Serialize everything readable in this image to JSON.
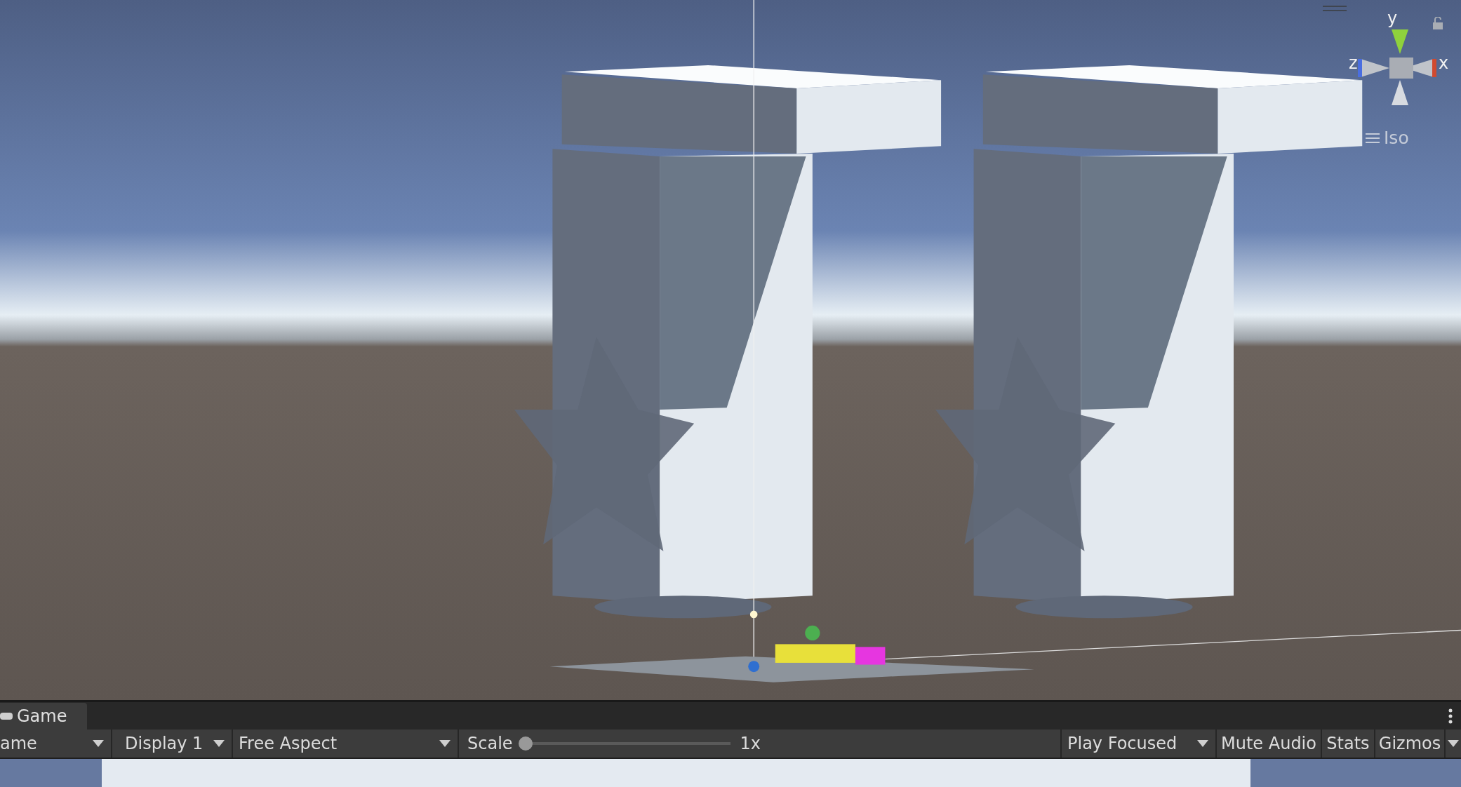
{
  "scene_view": {
    "gizmo": {
      "axis_labels": [
        {
          "kind": "y",
          "label": "y"
        },
        {
          "kind": "x",
          "label": "x"
        },
        {
          "kind": "z",
          "label": "z"
        }
      ],
      "projection": "Iso"
    }
  },
  "game_panel": {
    "tabs": [
      {
        "label": "Game",
        "selected": true
      }
    ],
    "toolbar": {
      "view_dropdown": "ame",
      "display_dropdown": "Display 1",
      "aspect_dropdown": "Free Aspect",
      "scale": {
        "label": "Scale",
        "level": 0,
        "reading": "1x"
      },
      "play_mode_dropdown": "Play Focused",
      "buttons": [
        "Mute Audio",
        "Stats"
      ],
      "gizmos_dropdown": "Gizmos"
    }
  }
}
